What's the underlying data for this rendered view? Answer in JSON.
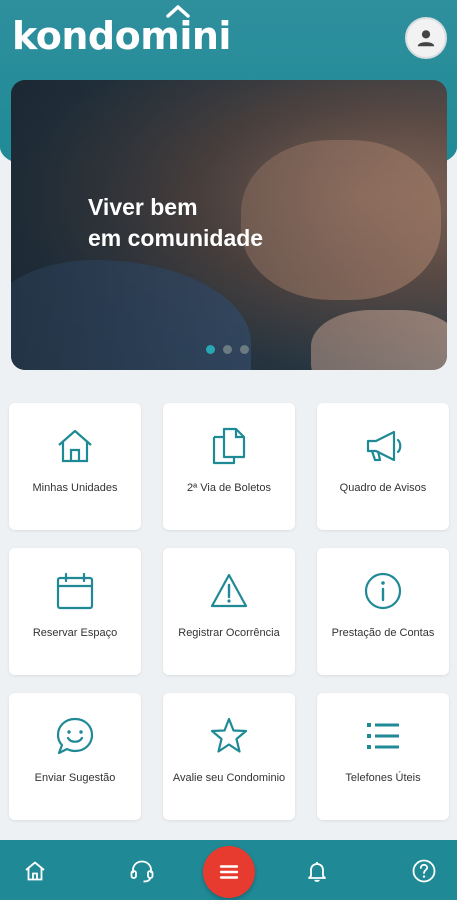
{
  "app": {
    "logo_text": "kondomini"
  },
  "banner": {
    "title_line1": "Viver bem",
    "title_line2": "em comunidade",
    "slide_count": 3,
    "active_slide": 1
  },
  "menu": {
    "items": [
      {
        "label": "Minhas Unidades",
        "icon": "home-icon"
      },
      {
        "label": "2ª Via de Boletos",
        "icon": "documents-icon"
      },
      {
        "label": "Quadro de Avisos",
        "icon": "megaphone-icon"
      },
      {
        "label": "Reservar Espaço",
        "icon": "calendar-icon"
      },
      {
        "label": "Registrar Ocorrência",
        "icon": "warning-icon"
      },
      {
        "label": "Prestação de Contas",
        "icon": "info-icon"
      },
      {
        "label": "Enviar Sugestão",
        "icon": "chat-smile-icon"
      },
      {
        "label": "Avalie seu Condominio",
        "icon": "star-icon"
      },
      {
        "label": "Telefones Úteis",
        "icon": "list-icon"
      }
    ]
  },
  "bottom_nav": {
    "items": [
      "home-icon",
      "headset-icon",
      "menu-icon",
      "bell-icon",
      "help-icon"
    ]
  },
  "colors": {
    "primary": "#1f8a96",
    "accent": "#28a8b6",
    "fab": "#e63b2e"
  }
}
